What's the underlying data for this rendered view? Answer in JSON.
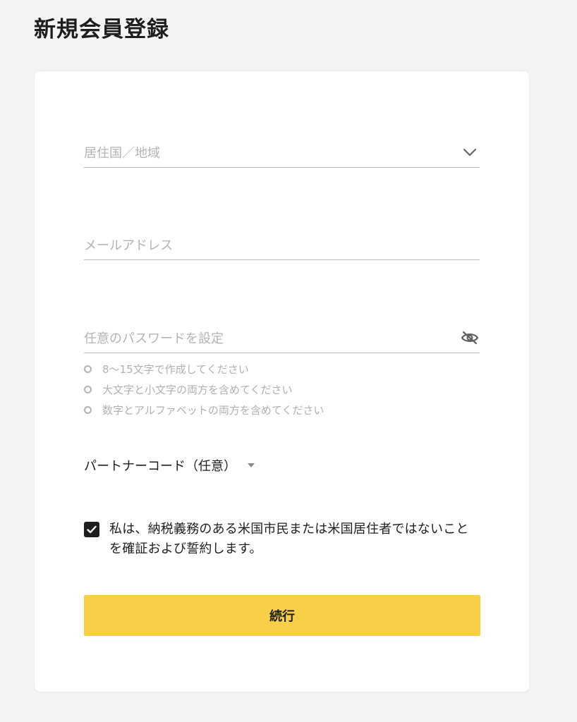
{
  "page": {
    "title": "新規会員登録"
  },
  "form": {
    "country": {
      "placeholder": "居住国／地域",
      "icon": "chevron-down-icon"
    },
    "email": {
      "placeholder": "メールアドレス"
    },
    "password": {
      "placeholder": "任意のパスワードを設定",
      "icon": "eye-slash-icon"
    },
    "password_hints": [
      "8〜15文字で作成してください",
      "大文字と小文字の両方を含めてください",
      "数字とアルファベットの両方を含めてください"
    ],
    "partner_code": {
      "label": "パートナーコード（任意）",
      "icon": "caret-down-icon"
    },
    "consent": {
      "checked": true,
      "text": "私は、納税義務のある米国市民または米国居住者ではないことを確証および誓約します。"
    },
    "continue_label": "続行"
  },
  "colors": {
    "background": "#f4f4f4",
    "card": "#ffffff",
    "accent": "#f8d047",
    "text": "#1e1e1e",
    "placeholder": "#b3b3b3"
  }
}
